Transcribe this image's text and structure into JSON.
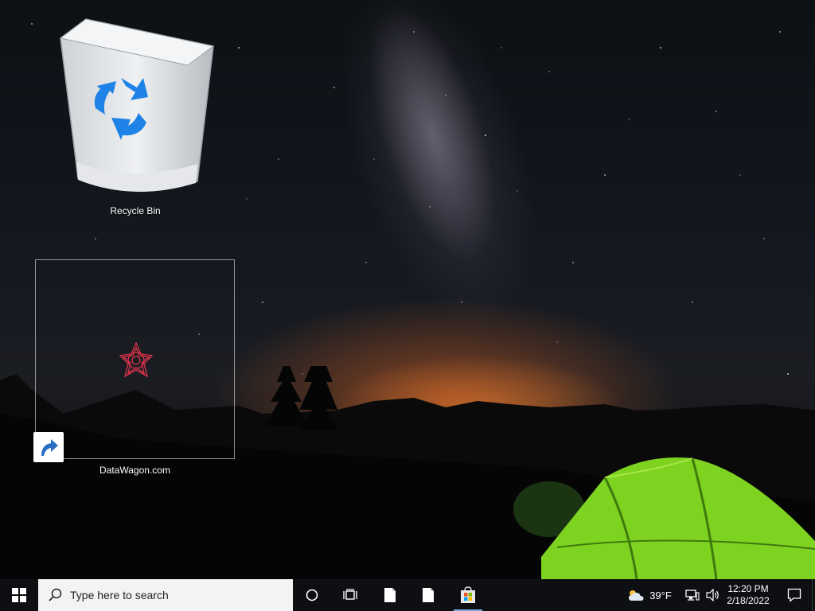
{
  "desktop": {
    "icons": [
      {
        "label": "Recycle Bin"
      },
      {
        "label": "DataWagon.com"
      }
    ]
  },
  "taskbar": {
    "search_placeholder": "Type here to search",
    "weather_temp": "39°F",
    "clock_time": "12:20 PM",
    "clock_date": "2/18/2022"
  },
  "colors": {
    "taskbar_bg": "#0e0f12",
    "search_bg": "#f3f3f3",
    "tent_green": "#7ed321",
    "horizon_glow": "#e26622"
  }
}
